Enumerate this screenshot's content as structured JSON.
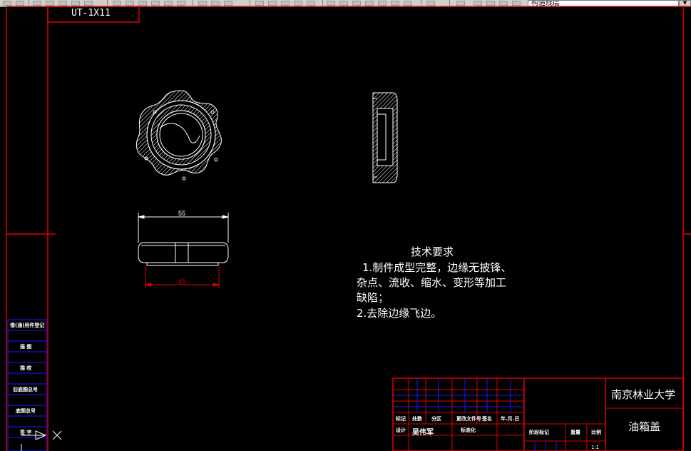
{
  "toolbar": {
    "layer_value": "构造线层",
    "dropdown_icon": "chevron-down-icon"
  },
  "drawing": {
    "code_box": "UT-1X11",
    "dimension_top": "55",
    "dimension_bottom": "45"
  },
  "tech_requirements": {
    "title": "技术要求",
    "lines": [
      "1.制件成型完整，边缘无披锋、",
      "杂点、流收、缩水、变形等加工",
      "缺陷；",
      "2.去除边缘飞边。"
    ]
  },
  "left_column_labels": [
    "借(通)用件登记",
    "描  图",
    "描  校",
    "旧底图总号",
    "底图总号",
    "签  字"
  ],
  "title_block": {
    "school": "南京林业大学",
    "part_name": "油箱盖",
    "row_labels_1": [
      "标记",
      "处数",
      "分区",
      "更改文件号",
      "签名",
      "年.月.日"
    ],
    "row_labels_2": [
      "设计",
      "吴伟军",
      "标准化",
      "阶段标记",
      "重量",
      "比例"
    ],
    "scale": "1:1"
  },
  "colors": {
    "frame_red": "#e00000",
    "grid_blue": "#1a1aff",
    "line_white": "#ffffff",
    "background": "#000000"
  }
}
